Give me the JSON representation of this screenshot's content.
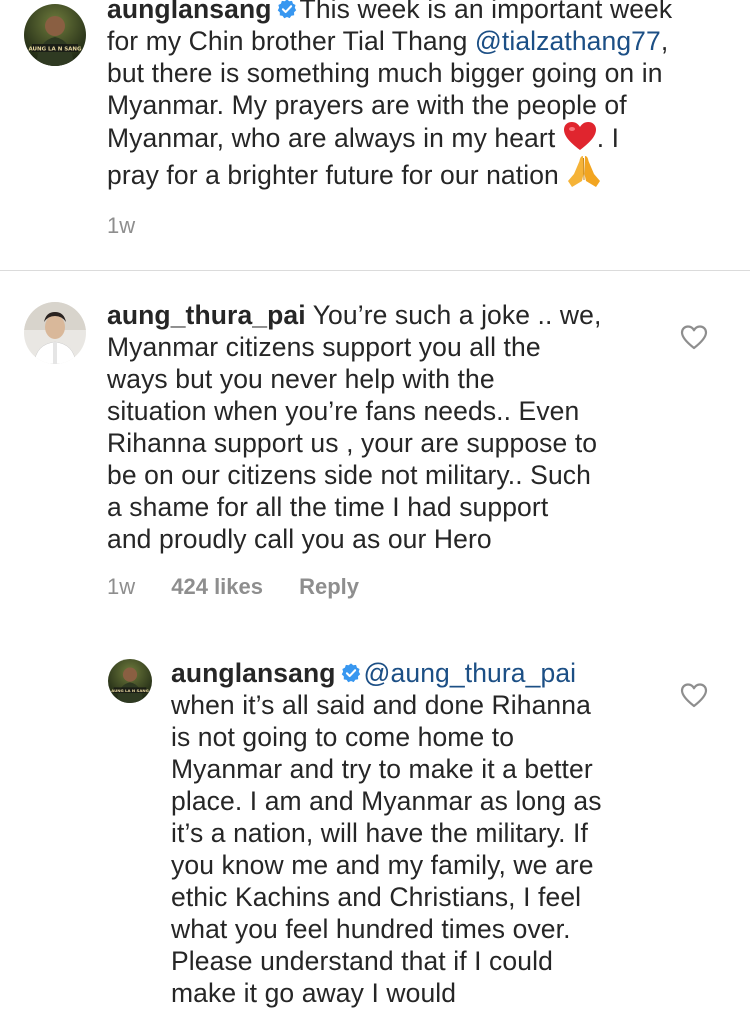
{
  "comments": [
    {
      "username": "aunglansang",
      "verified": true,
      "avatar_text": "AUNG LA N SANG",
      "lines": {
        "l1": "This week is an important week",
        "l2_pre": "for my Chin brother Tial Thang ",
        "l2_mention": "@tialzathang77",
        "l2_post": ",",
        "l3": "but there is something much bigger going on in",
        "l4": "Myanmar. My prayers are with the people of",
        "l5_pre": "Myanmar, who are always in my heart ",
        "l5_post": ". I",
        "l6": "pray for a brighter future for our nation "
      },
      "emojis": [
        "red-heart",
        "folded-hands"
      ],
      "time": "1w"
    },
    {
      "username": "aung_thura_pai",
      "verified": false,
      "lines": {
        "l1": " You’re such a joke .. we,",
        "l2": "Myanmar citizens support you all the",
        "l3": "ways but you never help with the",
        "l4": "situation when you’re fans needs.. Even",
        "l5": "Rihanna support us , your are suppose to",
        "l6": "be on our citizens side not military.. Such",
        "l7": "a shame for all the time I had support",
        "l8": "and proudly call you as our Hero"
      },
      "time": "1w",
      "likes": "424 likes",
      "reply_label": "Reply"
    },
    {
      "username": "aunglansang",
      "verified": true,
      "avatar_text": "AUNG LA N SANG",
      "mention": "@aung_thura_pai",
      "lines": {
        "l1": "when it’s all said and done Rihanna",
        "l2": "is not going to come home to",
        "l3": "Myanmar and try to make it a better",
        "l4": "place. I am and Myanmar as long as",
        "l5": "it’s a nation, will have the military. If",
        "l6": "you know me and my family, we are",
        "l7": "ethic Kachins and Christians, I feel",
        "l8": "what you feel hundred times over.",
        "l9": "Please understand that if I could",
        "l10": "make it go away I would"
      }
    }
  ],
  "colors": {
    "text": "#262626",
    "meta": "#8e8e8e",
    "mention": "#1c4f85",
    "verified": "#3897f0",
    "divider": "#dbdbdb"
  }
}
